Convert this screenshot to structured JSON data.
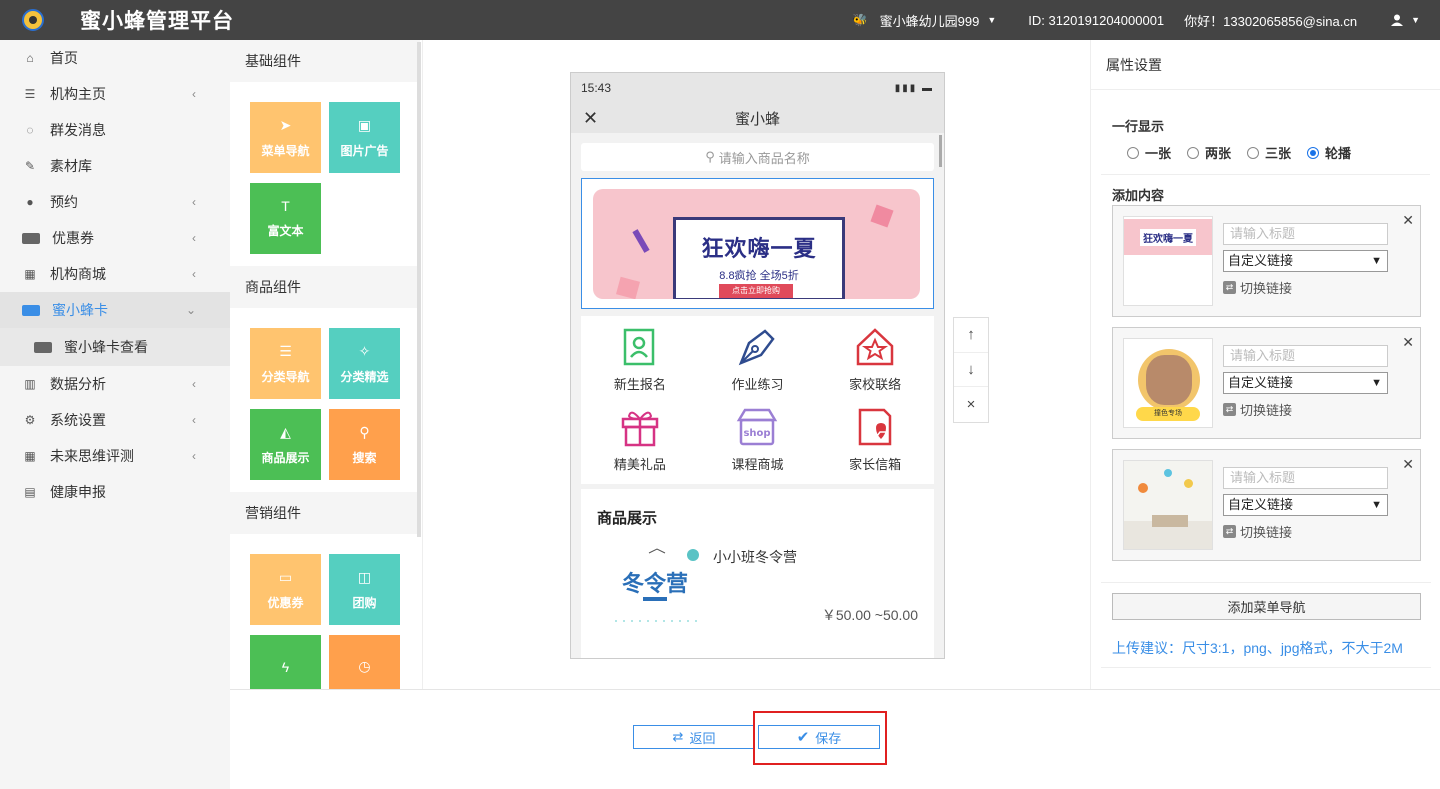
{
  "header": {
    "brand": "蜜小蜂管理平台",
    "school": "蜜小蜂幼儿园999",
    "id_text": "ID:  3120191204000001",
    "greeting": "你好！13302065856@sina.cn"
  },
  "sidebar": {
    "items": [
      {
        "label": "首页",
        "icon": "home-icon",
        "arrow": false
      },
      {
        "label": "机构主页",
        "icon": "list-icon",
        "arrow": true
      },
      {
        "label": "群发消息",
        "icon": "chat-icon",
        "arrow": false
      },
      {
        "label": "素材库",
        "icon": "edit-icon",
        "arrow": false
      },
      {
        "label": "预约",
        "icon": "users-icon",
        "arrow": true
      },
      {
        "label": "优惠券",
        "icon": "card-icon",
        "arrow": true
      },
      {
        "label": "机构商城",
        "icon": "building-icon",
        "arrow": true
      },
      {
        "label": "蜜小蜂卡",
        "icon": "card-icon",
        "arrow": true,
        "active": true
      },
      {
        "label": "数据分析",
        "icon": "bar-chart-icon",
        "arrow": true
      },
      {
        "label": "系统设置",
        "icon": "gears-icon",
        "arrow": true
      },
      {
        "label": "未来思维评测",
        "icon": "building-icon",
        "arrow": true
      },
      {
        "label": "健康申报",
        "icon": "id-card-icon",
        "arrow": false
      }
    ],
    "sub_item": "蜜小蜂卡查看"
  },
  "components": {
    "basic_title": "基础组件",
    "basic": [
      "菜单导航",
      "图片广告",
      "富文本"
    ],
    "goods_title": "商品组件",
    "goods": [
      "分类导航",
      "分类精选",
      "商品展示",
      "搜索"
    ],
    "marketing_title": "营销组件",
    "marketing": [
      "优惠券",
      "团购"
    ]
  },
  "phone": {
    "time": "15:43",
    "title": "蜜小蜂",
    "search_placeholder": "请输入商品名称",
    "banner": {
      "title": "狂欢嗨一夏",
      "sub": "8.8疯抢  全场5折",
      "button": "点击立即抢购"
    },
    "menu": [
      {
        "label": "新生报名",
        "color": "#3bbf6a"
      },
      {
        "label": "作业练习",
        "color": "#2f4c8f"
      },
      {
        "label": "家校联络",
        "color": "#d9363e"
      },
      {
        "label": "精美礼品",
        "color": "#d63384"
      },
      {
        "label": "课程商城",
        "color": "#9b7fd4"
      },
      {
        "label": "家长信箱",
        "color": "#d9363e"
      }
    ],
    "goods_title": "商品展示",
    "goods_name": "小小班冬令营",
    "goods_image_text": "冬令营",
    "goods_price": "￥50.00 ~50.00"
  },
  "move_tools": {
    "up": "↑",
    "down": "↓",
    "remove": "×"
  },
  "bottom": {
    "back_label": "返回",
    "save_label": "保存"
  },
  "props": {
    "title": "属性设置",
    "row_label": "一行显示",
    "options": [
      "一张",
      "两张",
      "三张",
      "轮播"
    ],
    "selected": "轮播",
    "add_label": "添加内容",
    "title_placeholder": "请输入标题",
    "link_option": "自定义链接",
    "switch_label": "切换链接",
    "thumb1_text": "狂欢嗨一夏",
    "thumb2_text": "撞色专场",
    "add_menu_label": "添加菜单导航",
    "tip": "上传建议：尺寸3:1，png、jpg格式，不大于2M"
  }
}
